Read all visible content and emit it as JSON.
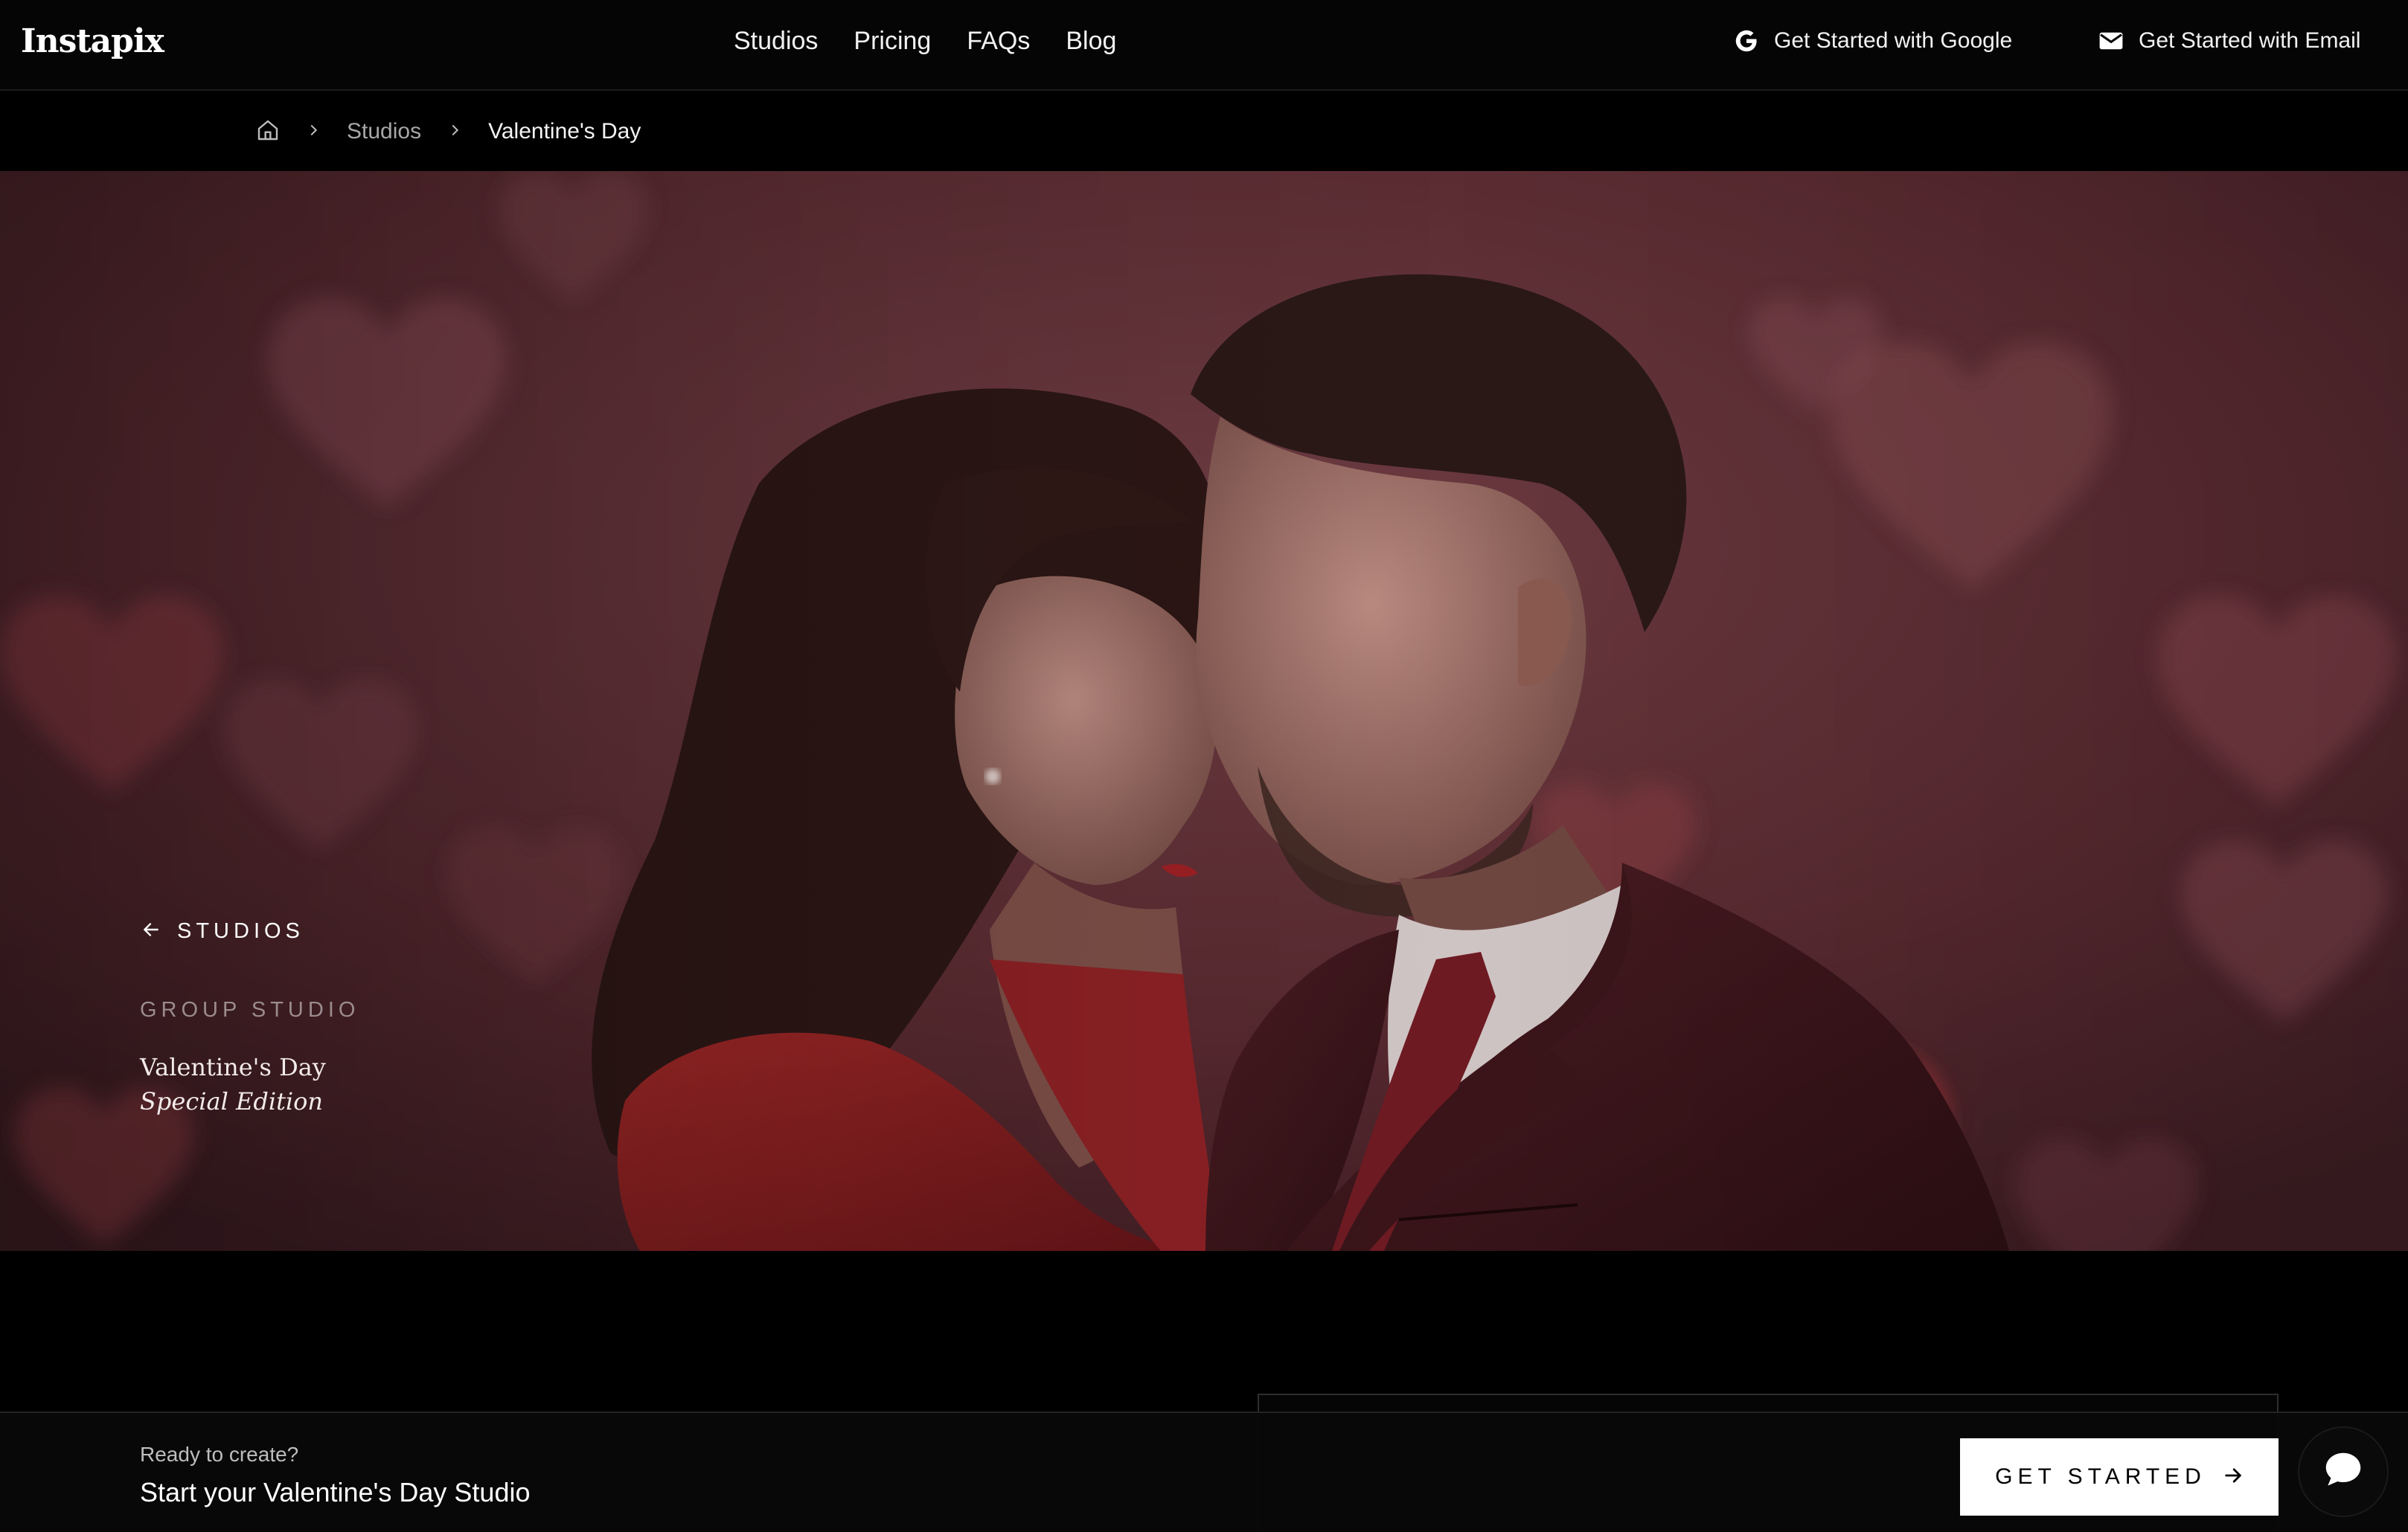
{
  "brand": {
    "logo_text": "Instapix"
  },
  "nav": {
    "links": [
      "Studios",
      "Pricing",
      "FAQs",
      "Blog"
    ],
    "google_cta": "Get Started with Google",
    "email_cta": "Get Started with Email"
  },
  "breadcrumb": {
    "home_icon": "home-icon",
    "items": [
      "Studios",
      "Valentine's Day"
    ]
  },
  "hero": {
    "back_label": "STUDIOS",
    "kicker": "GROUP STUDIO",
    "title": "Valentine's Day",
    "subtitle": "Special Edition",
    "image": "couple-portrait-with-heart-bokeh"
  },
  "sticky_bar": {
    "ready_text": "Ready to create?",
    "start_text": "Start your Valentine's Day Studio",
    "cta_label": "GET STARTED",
    "chat_icon": "chat-bubble-icon"
  },
  "colors": {
    "background": "#000000",
    "hero_tint": "#5a2e34",
    "cta_bg": "#ffffff",
    "accent_red": "#b02a2e"
  }
}
